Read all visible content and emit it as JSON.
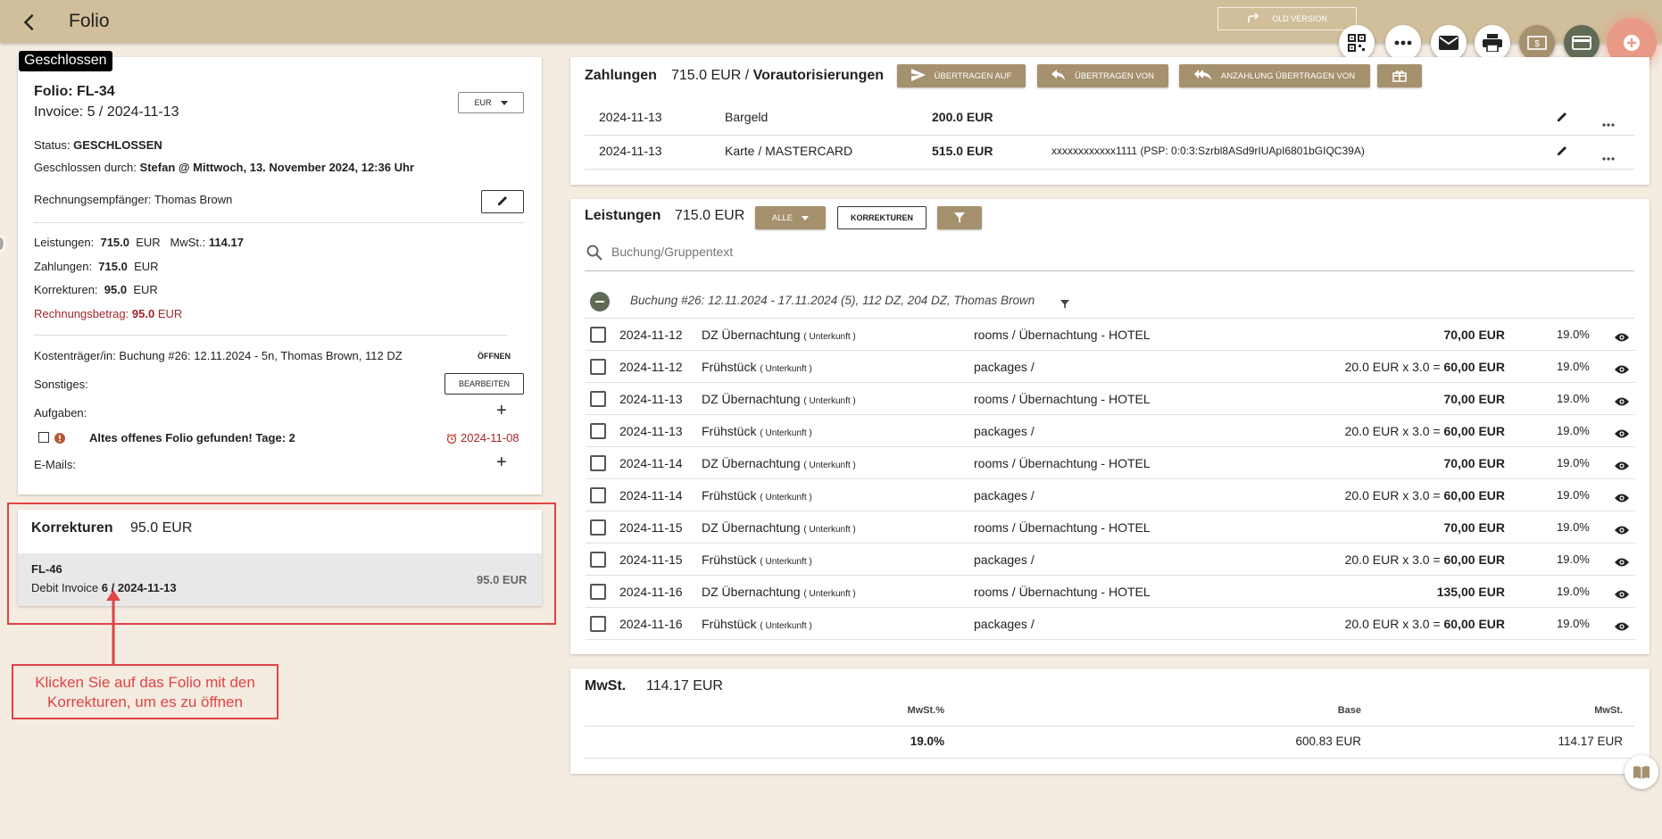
{
  "app": {
    "title": "Folio",
    "old_version": "OLD VERSION"
  },
  "badge": "Geschlossen",
  "folio": {
    "title": "Folio: FL-34",
    "invoice": "Invoice: 5 / 2024-11-13",
    "currency": "EUR",
    "status_label": "Status:",
    "status": "GESCHLOSSEN",
    "closed_by_label": "Geschlossen durch:",
    "closed_by": "Stefan @ Mittwoch, 13. November 2024, 12:36 Uhr",
    "recipient_label": "Rechnungsempfänger:",
    "recipient": "Thomas Brown",
    "services_label": "Leistungen:",
    "services_value": "715.0",
    "services_cur": "EUR",
    "vat_label": "MwSt.:",
    "vat_value": "114.17",
    "payments_label": "Zahlungen:",
    "payments_value": "715.0",
    "payments_cur": "EUR",
    "corrections_label": "Korrekturen:",
    "corrections_value": "95.0",
    "corrections_cur": "EUR",
    "invoice_amount_label": "Rechnungsbetrag:",
    "invoice_amount": "95.0",
    "invoice_amount_cur": "EUR",
    "payer_label": "Kostenträger/in:",
    "payer": "Buchung #26: 12.11.2024 - 5n, Thomas Brown, 112 DZ",
    "open_btn": "ÖFFNEN",
    "other_label": "Sonstiges:",
    "edit_btn": "BEARBEITEN",
    "tasks_label": "Aufgaben:",
    "task_text": "Altes offenes Folio gefunden! Tage: 2",
    "task_date": "2024-11-08",
    "emails_label": "E-Mails:"
  },
  "corrections_card": {
    "title": "Korrekturen",
    "total": "95.0 EUR",
    "item_id": "FL-46",
    "item_prefix": "Debit Invoice ",
    "item_invoice": "6 / 2024-11-13",
    "item_amount": "95.0 EUR"
  },
  "annotation": {
    "line1": "Klicken Sie auf das Folio mit den",
    "line2": "Korrekturen, um es zu öffnen"
  },
  "payments": {
    "title": "Zahlungen",
    "total": "715.0 EUR",
    "separator": "/",
    "preauth": "Vorautorisierungen",
    "btn_transfer_to": "ÜBERTRAGEN AUF",
    "btn_transfer_from": "ÜBERTRAGEN VON",
    "btn_deposit": "ANZAHLUNG ÜBERTRAGEN VON",
    "rows": [
      {
        "date": "2024-11-13",
        "method": "Bargeld",
        "amount": "200.0 EUR",
        "info": ""
      },
      {
        "date": "2024-11-13",
        "method": "Karte / MASTERCARD",
        "amount": "515.0 EUR",
        "info": "xxxxxxxxxxxx1111 (PSP: 0:0:3:Szrbl8ASd9rIUApI6801bGIQC39A)"
      }
    ]
  },
  "services": {
    "title": "Leistungen",
    "total": "715.0 EUR",
    "filter_all": "ALLE",
    "btn_corrections": "KORREKTUREN",
    "search_placeholder": "Buchung/Gruppentext",
    "group_text": "Buchung #26: 12.11.2024 - 17.11.2024 (5), 112 DZ, 204 DZ, Thomas Brown",
    "rows": [
      {
        "date": "2024-11-12",
        "name": "DZ Übernachtung",
        "tag": "( Unterkunft )",
        "cat": "rooms / Übernachtung - HOTEL",
        "calc": "",
        "amount": "70,00 EUR",
        "vat": "19.0%"
      },
      {
        "date": "2024-11-12",
        "name": "Frühstück",
        "tag": "( Unterkunft )",
        "cat": "packages /",
        "calc": "20.0 EUR x 3.0 =",
        "amount": "60,00 EUR",
        "vat": "19.0%"
      },
      {
        "date": "2024-11-13",
        "name": "DZ Übernachtung",
        "tag": "( Unterkunft )",
        "cat": "rooms / Übernachtung - HOTEL",
        "calc": "",
        "amount": "70,00 EUR",
        "vat": "19.0%"
      },
      {
        "date": "2024-11-13",
        "name": "Frühstück",
        "tag": "( Unterkunft )",
        "cat": "packages /",
        "calc": "20.0 EUR x 3.0 =",
        "amount": "60,00 EUR",
        "vat": "19.0%"
      },
      {
        "date": "2024-11-14",
        "name": "DZ Übernachtung",
        "tag": "( Unterkunft )",
        "cat": "rooms / Übernachtung - HOTEL",
        "calc": "",
        "amount": "70,00 EUR",
        "vat": "19.0%"
      },
      {
        "date": "2024-11-14",
        "name": "Frühstück",
        "tag": "( Unterkunft )",
        "cat": "packages /",
        "calc": "20.0 EUR x 3.0 =",
        "amount": "60,00 EUR",
        "vat": "19.0%"
      },
      {
        "date": "2024-11-15",
        "name": "DZ Übernachtung",
        "tag": "( Unterkunft )",
        "cat": "rooms / Übernachtung - HOTEL",
        "calc": "",
        "amount": "70,00 EUR",
        "vat": "19.0%"
      },
      {
        "date": "2024-11-15",
        "name": "Frühstück",
        "tag": "( Unterkunft )",
        "cat": "packages /",
        "calc": "20.0 EUR x 3.0 =",
        "amount": "60,00 EUR",
        "vat": "19.0%"
      },
      {
        "date": "2024-11-16",
        "name": "DZ Übernachtung",
        "tag": "( Unterkunft )",
        "cat": "rooms / Übernachtung - HOTEL",
        "calc": "",
        "amount": "135,00 EUR",
        "vat": "19.0%"
      },
      {
        "date": "2024-11-16",
        "name": "Frühstück",
        "tag": "( Unterkunft )",
        "cat": "packages /",
        "calc": "20.0 EUR x 3.0 =",
        "amount": "60,00 EUR",
        "vat": "19.0%"
      }
    ]
  },
  "vat": {
    "title": "MwSt.",
    "total": "114.17 EUR",
    "col_rate": "MwSt.%",
    "col_base": "Base",
    "col_vat": "MwSt.",
    "rate": "19.0%",
    "base": "600.83 EUR",
    "vat_amount": "114.17 EUR"
  },
  "icons": [
    "back-arrow-icon",
    "redo-icon",
    "qr-code-icon",
    "more-horiz-icon",
    "mail-icon",
    "print-icon",
    "dollar-note-icon",
    "credit-card-icon",
    "add-circle-icon",
    "pencil-icon",
    "send-icon",
    "reply-icon",
    "reply-all-icon",
    "gift-icon",
    "search-icon",
    "filter-icon",
    "eye-icon",
    "alarm-icon",
    "error-icon",
    "remove-circle-icon",
    "book-icon"
  ],
  "colors": {
    "topbar": "#d1bf9b",
    "accent_brown": "#a6916e",
    "background": "#f4ebe1",
    "alert_red": "#e04444",
    "group_green": "#5f6b55",
    "fab_plus": "#e99a86"
  }
}
